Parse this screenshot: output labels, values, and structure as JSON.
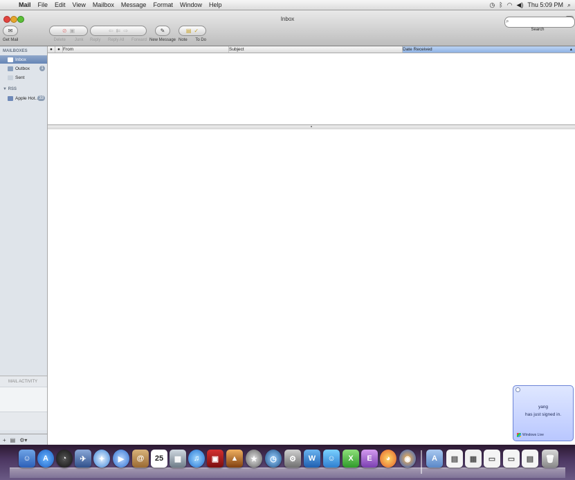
{
  "menubar": {
    "app": "Mail",
    "menus": [
      "File",
      "Edit",
      "View",
      "Mailbox",
      "Message",
      "Format",
      "Window",
      "Help"
    ],
    "clock": "Thu 5:09 PM"
  },
  "window": {
    "title": "Inbox"
  },
  "toolbar": {
    "get_mail": "Get Mail",
    "delete": "Delete",
    "junk": "Junk",
    "reply": "Reply",
    "reply_all": "Reply All",
    "forward": "Forward",
    "new_message": "New Message",
    "note": "Note",
    "todo": "To Do",
    "search_label": "Search",
    "search_placeholder": ""
  },
  "sidebar": {
    "mailboxes_heading": "MAILBOXES",
    "items": [
      {
        "label": "Inbox",
        "badge": ""
      },
      {
        "label": "Outbox",
        "badge": "1"
      },
      {
        "label": "Sent",
        "badge": ""
      }
    ],
    "rss_heading": "RSS",
    "rss_items": [
      {
        "label": "Apple Hot…",
        "badge": "33"
      }
    ],
    "activity_heading": "MAIL ACTIVITY"
  },
  "list": {
    "columns": [
      "From",
      "Subject",
      "Date Received"
    ],
    "sorted_column": "Date Received"
  },
  "notification": {
    "line1": "yang",
    "line2": "has just signed in.",
    "brand": "Windows Live"
  },
  "dock": {
    "apps": [
      "finder-icon",
      "app-store-icon",
      "dashboard-icon",
      "mission-icon",
      "safari-icon",
      "facetime-icon",
      "address-book-icon",
      "ical-icon",
      "iphoto-icon",
      "itunes-icon",
      "photo-booth-icon",
      "iphoto2-icon",
      "imovie-icon",
      "time-machine-icon",
      "system-prefs-icon",
      "word-icon",
      "messenger-icon",
      "excel-icon",
      "entourage-icon",
      "powerpoint-icon",
      "firefox-icon"
    ],
    "date_badge": "25"
  }
}
